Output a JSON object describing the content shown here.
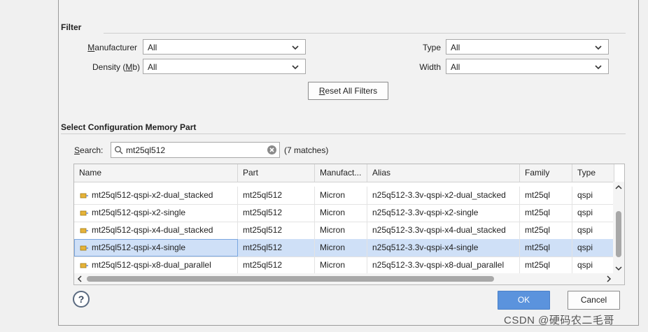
{
  "filter": {
    "title": "Filter",
    "manufacturer": {
      "label_pre": "",
      "label_key": "M",
      "label_post": "anufacturer",
      "value": "All"
    },
    "density": {
      "label_pre": "Density (",
      "label_key": "M",
      "label_post": "b)",
      "value": "All"
    },
    "type": {
      "label": "Type",
      "value": "All"
    },
    "width": {
      "label": "Width",
      "value": "All"
    },
    "reset": {
      "label_key": "R",
      "label_post": "eset All Filters"
    }
  },
  "select": {
    "title": "Select Configuration Memory Part",
    "search_label_key": "S",
    "search_label_post": "earch:",
    "search_value": "mt25ql512",
    "matches": "(7 matches)"
  },
  "table": {
    "columns": [
      "Name",
      "Part",
      "Manufact...",
      "Alias",
      "Family",
      "Type"
    ],
    "rows": [
      {
        "name": "mt25ql512-qspi-x2-dual_stacked",
        "part": "mt25ql512",
        "manufacturer": "Micron",
        "alias": "n25q512-3.3v-qspi-x2-dual_stacked",
        "family": "mt25ql",
        "type": "qspi"
      },
      {
        "name": "mt25ql512-qspi-x2-single",
        "part": "mt25ql512",
        "manufacturer": "Micron",
        "alias": "n25q512-3.3v-qspi-x2-single",
        "family": "mt25ql",
        "type": "qspi"
      },
      {
        "name": "mt25ql512-qspi-x4-dual_stacked",
        "part": "mt25ql512",
        "manufacturer": "Micron",
        "alias": "n25q512-3.3v-qspi-x4-dual_stacked",
        "family": "mt25ql",
        "type": "qspi"
      },
      {
        "name": "mt25ql512-qspi-x4-single",
        "part": "mt25ql512",
        "manufacturer": "Micron",
        "alias": "n25q512-3.3v-qspi-x4-single",
        "family": "mt25ql",
        "type": "qspi",
        "selected": true
      },
      {
        "name": "mt25ql512-qspi-x8-dual_parallel",
        "part": "mt25ql512",
        "manufacturer": "Micron",
        "alias": "n25q512-3.3v-qspi-x8-dual_parallel",
        "family": "mt25ql",
        "type": "qspi"
      }
    ]
  },
  "buttons": {
    "help": "?",
    "ok": "OK",
    "cancel": "Cancel"
  },
  "watermark": "CSDN @硬码农二毛哥"
}
